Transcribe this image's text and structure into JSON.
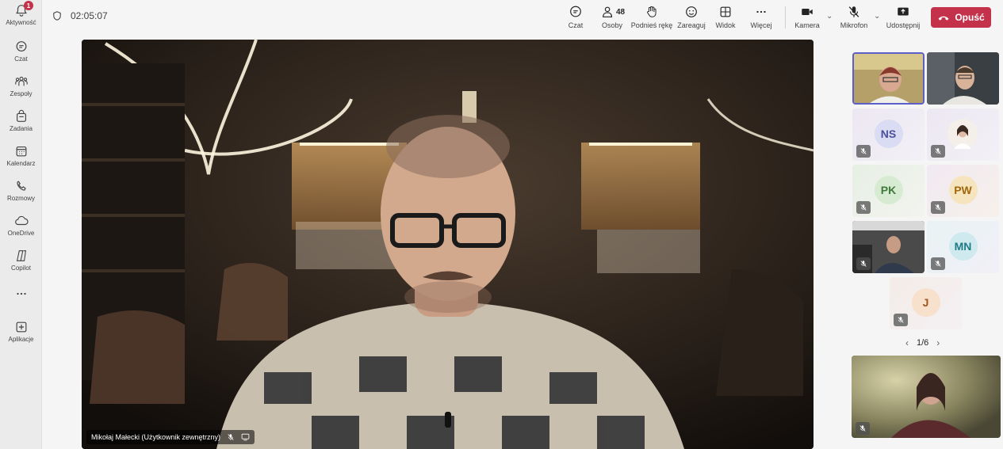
{
  "rail": {
    "items": [
      {
        "label": "Aktywność",
        "icon": "bell-icon",
        "badge": "1"
      },
      {
        "label": "Czat",
        "icon": "chat-icon"
      },
      {
        "label": "Zespoły",
        "icon": "teams-icon"
      },
      {
        "label": "Zadania",
        "icon": "tasks-icon"
      },
      {
        "label": "Kalendarz",
        "icon": "calendar-icon"
      },
      {
        "label": "Rozmowy",
        "icon": "phone-icon"
      },
      {
        "label": "OneDrive",
        "icon": "cloud-icon"
      },
      {
        "label": "Copilot",
        "icon": "copilot-icon"
      },
      {
        "label": "",
        "icon": "more-icon"
      },
      {
        "label": "Aplikacje",
        "icon": "add-app-icon"
      }
    ]
  },
  "meeting": {
    "timer": "02:05:07",
    "tools": {
      "chat": "Czat",
      "people": "Osoby",
      "people_count": "48",
      "raise_hand": "Podnieś rękę",
      "react": "Zareaguj",
      "view": "Widok",
      "more": "Więcej",
      "camera": "Kamera",
      "mic": "Mikrofon",
      "share": "Udostępnij",
      "leave": "Opuść"
    },
    "accent": "#5b5fc7",
    "leave_color": "#c4314b"
  },
  "stage": {
    "speaker": "Mikołaj Małecki (Użytkownik zewnętrzny)"
  },
  "gallery": {
    "participants": [
      {
        "initials": "NS",
        "muted": true
      },
      {
        "initials": "PK",
        "muted": true
      },
      {
        "initials": "PW",
        "muted": true
      },
      {
        "initials": "MN",
        "muted": true
      },
      {
        "initials": "J",
        "muted": true
      }
    ],
    "page": "1/6"
  }
}
